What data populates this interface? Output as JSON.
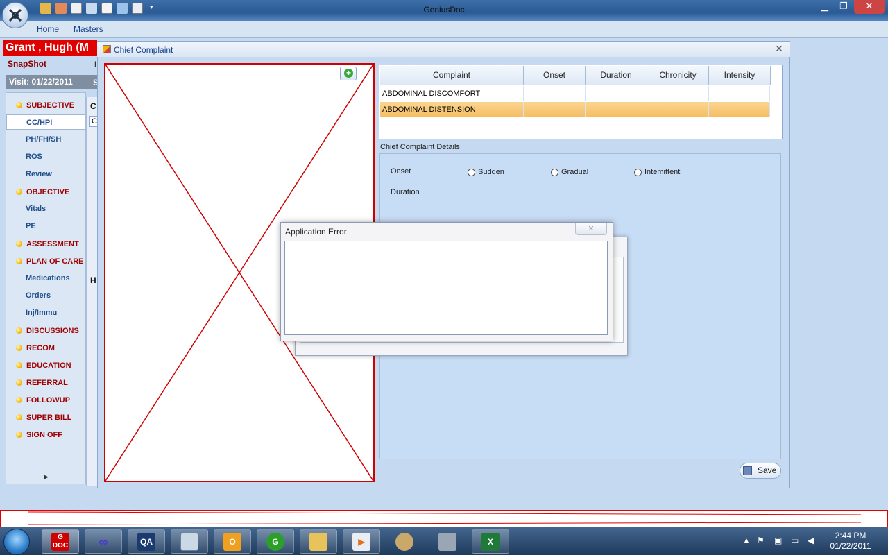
{
  "app": {
    "title": "GeniusDoc"
  },
  "ribbon": {
    "tabs": [
      "Home",
      "Masters"
    ]
  },
  "patient": {
    "name": "Grant , Hugh (M"
  },
  "snapshot_label": "SnapShot",
  "visit_label": "Visit:  01/22/2011",
  "nav": {
    "items": [
      {
        "label": "SUBJECTIVE",
        "type": "section"
      },
      {
        "label": "CC/HPI",
        "type": "sub",
        "active": true
      },
      {
        "label": "PH/FH/SH",
        "type": "sub"
      },
      {
        "label": "ROS",
        "type": "sub"
      },
      {
        "label": "Review",
        "type": "sub"
      },
      {
        "label": "OBJECTIVE",
        "type": "section"
      },
      {
        "label": "Vitals",
        "type": "sub"
      },
      {
        "label": "PE",
        "type": "sub"
      },
      {
        "label": "ASSESSMENT",
        "type": "section"
      },
      {
        "label": "PLAN OF CARE",
        "type": "section"
      },
      {
        "label": "Medications",
        "type": "sub"
      },
      {
        "label": "Orders",
        "type": "sub"
      },
      {
        "label": "Inj/Immu",
        "type": "sub"
      },
      {
        "label": "DISCUSSIONS",
        "type": "section"
      },
      {
        "label": "RECOM",
        "type": "section"
      },
      {
        "label": "EDUCATION",
        "type": "section"
      },
      {
        "label": "REFERRAL",
        "type": "section"
      },
      {
        "label": "FOLLOWUP",
        "type": "section"
      },
      {
        "label": "SUPER BILL",
        "type": "section"
      },
      {
        "label": "SIGN OFF",
        "type": "section"
      }
    ]
  },
  "background_fragments": {
    "c1": "C",
    "c2": "C",
    "h": "H",
    "s": "S",
    "i": "I"
  },
  "dialog": {
    "title": "Chief Complaint",
    "grid": {
      "columns": [
        "Complaint",
        "Onset",
        "Duration",
        "Chronicity",
        "Intensity"
      ],
      "rows": [
        {
          "complaint": "ABDOMINAL DISCOMFORT",
          "selected": false
        },
        {
          "complaint": "ABDOMINAL DISTENSION",
          "selected": true
        }
      ]
    },
    "details": {
      "label": "Chief Complaint Details",
      "onset_label": "Onset",
      "onset_options": [
        "Sudden",
        "Gradual",
        "Intemittent"
      ],
      "duration_label": "Duration"
    },
    "save_label": "Save"
  },
  "error_dialog": {
    "title": "Application Error",
    "close_glyph": "✕"
  },
  "taskbar": {
    "icons": [
      "gdoc-icon",
      "infinity-icon",
      "qa-icon",
      "explorer-icon",
      "outlook-icon",
      "g-app-icon",
      "folder-icon",
      "media-icon",
      "paint-icon",
      "tools-icon",
      "excel-icon"
    ],
    "gdoc_text": "G DOC",
    "qa_text": "QA",
    "g_text": "G",
    "excel_text": "X",
    "time": "2:44 PM",
    "date": "01/22/2011"
  },
  "colors": {
    "accent_red": "#e00000",
    "nav_section": "#a00000",
    "nav_sub": "#1f4e89",
    "selected_row": "#f9c97a",
    "panel_blue": "#c5d9f1"
  }
}
